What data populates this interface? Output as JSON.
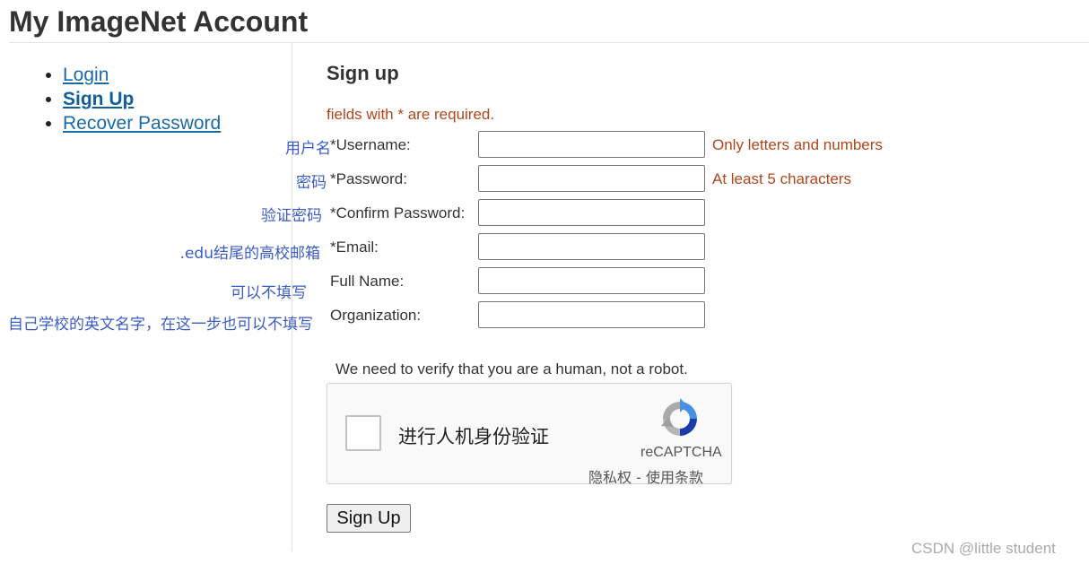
{
  "page": {
    "title": "My ImageNet Account"
  },
  "nav": {
    "items": [
      {
        "label": "Login"
      },
      {
        "label": "Sign Up"
      },
      {
        "label": "Recover Password"
      }
    ]
  },
  "form": {
    "title": "Sign up",
    "required_note": "fields with * are required.",
    "fields": [
      {
        "label": "*Username:",
        "value": "",
        "hint": "Only letters and numbers",
        "note": "用户名"
      },
      {
        "label": "*Password:",
        "value": "",
        "hint": "At least 5 characters",
        "note": "密码"
      },
      {
        "label": "*Confirm Password:",
        "value": "",
        "hint": "",
        "note": "验证密码"
      },
      {
        "label": "*Email:",
        "value": "",
        "hint": "",
        "note": ".edu结尾的高校邮箱"
      },
      {
        "label": "Full Name:",
        "value": "",
        "hint": "",
        "note": "可以不填写"
      },
      {
        "label": "Organization:",
        "value": "",
        "hint": "",
        "note": "自己学校的英文名字，在这一步也可以不填写"
      }
    ],
    "human_check_text": "We need to verify that you are a human, not a robot.",
    "submit_label": "Sign Up"
  },
  "captcha": {
    "checkbox_label": "进行人机身份验证",
    "brand": "reCAPTCHA",
    "links": "隐私权 - 使用条款",
    "logo_icon": "recaptcha-logo-icon",
    "checked": false
  },
  "watermark": "CSDN @little student",
  "colors": {
    "link": "#1b6aa5",
    "hint": "#b0461b",
    "annotation": "#3b5cc4"
  }
}
